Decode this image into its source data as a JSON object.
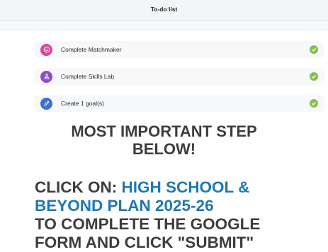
{
  "header": {
    "title": "To-do list"
  },
  "tasks": [
    {
      "label": "Complete Matchmaker",
      "icon": "smiley-icon",
      "icon_color": "#d9489a",
      "completed": true
    },
    {
      "label": "Complete Skills Lab",
      "icon": "flask-icon",
      "icon_color": "#8b4fc6",
      "completed": true
    },
    {
      "label": "Create 1 goal(s)",
      "icon": "pencil-icon",
      "icon_color": "#3d6fd1",
      "completed": true
    }
  ],
  "notice": {
    "line1": "MOST IMPORTANT STEP",
    "line2": "BELOW!"
  },
  "cta": {
    "prefix": "CLICK ON: ",
    "link_line1": "HIGH SCHOOL &",
    "link_line2": "BEYOND PLAN 2025-26",
    "line3": "TO COMPLETE THE GOOGLE",
    "line4": "FORM AND CLICK \"SUBMIT\""
  },
  "colors": {
    "check": "#7fc34a",
    "link": "#1f78b4",
    "text": "#3d3d3d"
  }
}
